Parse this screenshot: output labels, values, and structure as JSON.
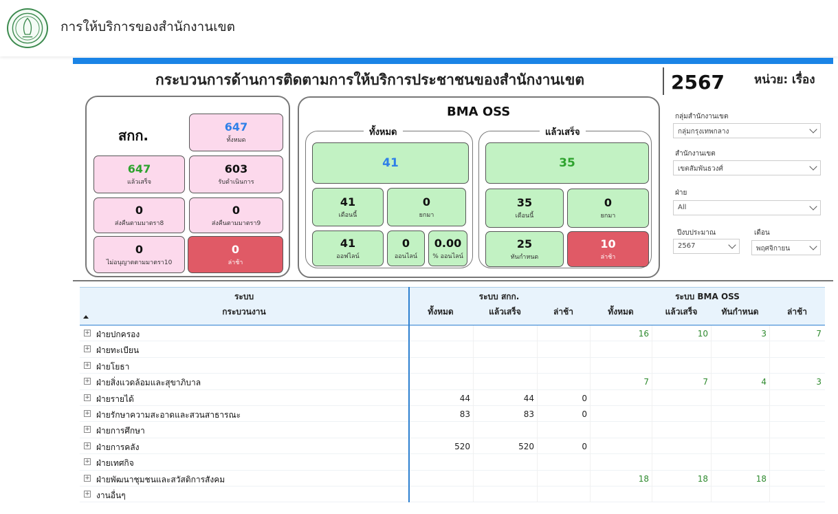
{
  "header": {
    "app_title": "การให้บริการของสำนักงานเขต"
  },
  "report": {
    "title": "กระบวนการด้านการติดตามการให้บริการประชาชนของสำนักงานเขต",
    "year": "2567",
    "unit": "หน่วย: เรื่อง"
  },
  "sakk": {
    "title": "สกก.",
    "cards": [
      {
        "value": "647",
        "label": "ทั้งหมด"
      },
      {
        "value": "647",
        "label": "แล้วเสร็จ"
      },
      {
        "value": "603",
        "label": "รับดำเนินการ"
      },
      {
        "value": "0",
        "label": "ส่งคืนตามมาตรา8"
      },
      {
        "value": "0",
        "label": "ส่งคืนตามมาตรา9"
      },
      {
        "value": "0",
        "label": "ไม่อนุญาตตามมาตรา10"
      },
      {
        "value": "0",
        "label": "ล่าช้า"
      }
    ]
  },
  "oss": {
    "title": "BMA OSS",
    "all": {
      "label": "ทั้งหมด",
      "total": "41",
      "cards": [
        {
          "value": "41",
          "label": "เดือนนี้"
        },
        {
          "value": "0",
          "label": "ยกมา"
        },
        {
          "value": "41",
          "label": "ออฟไลน์"
        },
        {
          "value": "0",
          "label": "ออนไลน์"
        },
        {
          "value": "0.00",
          "label": "% ออนไลน์"
        }
      ]
    },
    "done": {
      "label": "แล้วเสร็จ",
      "total": "35",
      "cards": [
        {
          "value": "35",
          "label": "เดือนนี้"
        },
        {
          "value": "0",
          "label": "ยกมา"
        },
        {
          "value": "25",
          "label": "ทันกำหนด"
        },
        {
          "value": "10",
          "label": "ล่าช้า"
        }
      ]
    }
  },
  "filters": {
    "group": {
      "label": "กลุ่มสำนักงานเขต",
      "value": "กลุ่มกรุงเทพกลาง"
    },
    "district": {
      "label": "สำนักงานเขต",
      "value": "เขตสัมพันธวงศ์"
    },
    "division": {
      "label": "ฝ่าย",
      "value": "All"
    },
    "fiscal_year": {
      "label": "ปีงบประมาณ",
      "value": "2567"
    },
    "month": {
      "label": "เดือน",
      "value": "พฤศจิกายน"
    }
  },
  "table": {
    "h_system": "ระบบ",
    "h_process": "กระบวนงาน",
    "h_sakk": "ระบบ สกก.",
    "h_oss": "ระบบ BMA OSS",
    "cols": [
      "ทั้งหมด",
      "แล้วเสร็จ",
      "ล่าช้า",
      "ทั้งหมด",
      "แล้วเสร็จ",
      "ทันกำหนด",
      "ล่าช้า"
    ],
    "rows": [
      {
        "name": "ฝ่ายปกครอง",
        "v": [
          "",
          "",
          "",
          "16",
          "10",
          "3",
          "7"
        ]
      },
      {
        "name": "ฝ่ายทะเบียน",
        "v": [
          "",
          "",
          "",
          "",
          "",
          "",
          ""
        ]
      },
      {
        "name": "ฝ่ายโยธา",
        "v": [
          "",
          "",
          "",
          "",
          "",
          "",
          ""
        ]
      },
      {
        "name": "ฝ่ายสิ่งแวดล้อมและสุขาภิบาล",
        "v": [
          "",
          "",
          "",
          "7",
          "7",
          "4",
          "3"
        ]
      },
      {
        "name": "ฝ่ายรายได้",
        "v": [
          "44",
          "44",
          "0",
          "",
          "",
          "",
          ""
        ]
      },
      {
        "name": "ฝ่ายรักษาความสะอาดและสวนสาธารณะ",
        "v": [
          "83",
          "83",
          "0",
          "",
          "",
          "",
          ""
        ]
      },
      {
        "name": "ฝ่ายการศึกษา",
        "v": [
          "",
          "",
          "",
          "",
          "",
          "",
          ""
        ]
      },
      {
        "name": "ฝ่ายการคลัง",
        "v": [
          "520",
          "520",
          "0",
          "",
          "",
          "",
          ""
        ]
      },
      {
        "name": "ฝ่ายเทศกิจ",
        "v": [
          "",
          "",
          "",
          "",
          "",
          "",
          ""
        ]
      },
      {
        "name": "ฝ่ายพัฒนาชุมชนและสวัสดิการสังคม",
        "v": [
          "",
          "",
          "",
          "18",
          "18",
          "18",
          ""
        ]
      },
      {
        "name": "งานอื่นๆ",
        "v": [
          "",
          "",
          "",
          "",
          "",
          "",
          ""
        ]
      }
    ]
  }
}
